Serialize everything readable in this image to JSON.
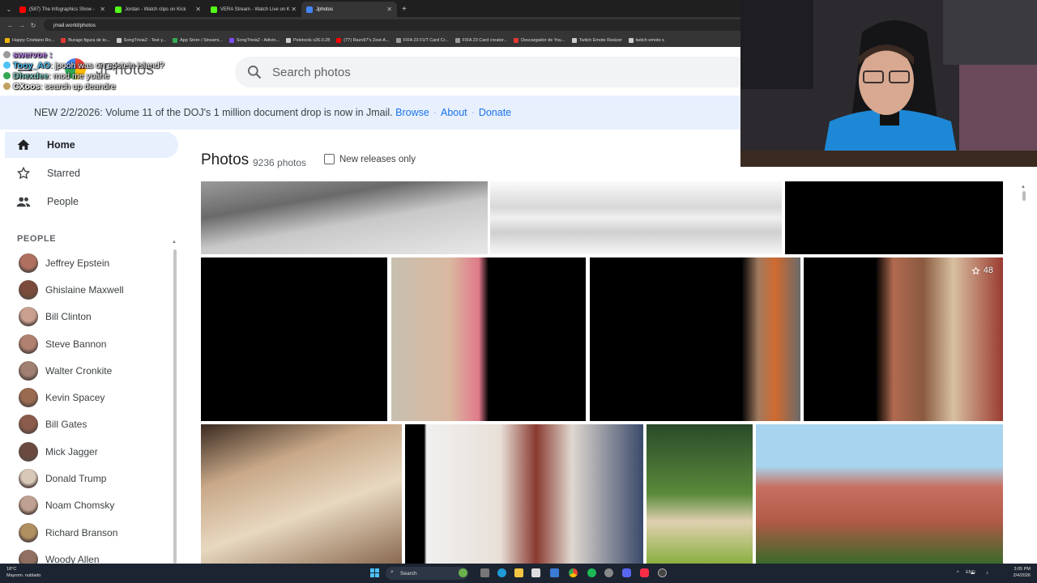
{
  "browser": {
    "tabs": [
      {
        "label": "(587) The Infographics Show -",
        "color": "#ff0000"
      },
      {
        "label": "Jordan - Watch clips on Kick",
        "color": "#53fc18"
      },
      {
        "label": "VERA Stream - Watch Live on K",
        "color": "#53fc18"
      },
      {
        "label": "Jphotos",
        "color": "#4285f4"
      }
    ],
    "url": "jmail.world/photos",
    "bookmarks": [
      {
        "label": "Happy Cristiano Ro...",
        "color": "#f4b400"
      },
      {
        "label": "Burago figura de to...",
        "color": "#e53935"
      },
      {
        "label": "SongTrivia2 - Test y...",
        "color": "#cccccc"
      },
      {
        "label": "App Store / Streami...",
        "color": "#34a853"
      },
      {
        "label": "SongTrivia2 - Adivin...",
        "color": "#7c4dff"
      },
      {
        "label": "Peletools v26.0.28",
        "color": "#cccccc"
      },
      {
        "label": "(77) Razo97's Zest-A...",
        "color": "#ff0000"
      },
      {
        "label": "FIFA 23 FUT Card Cr...",
        "color": "#999999"
      },
      {
        "label": "FIFA 23 Card creator...",
        "color": "#999999"
      },
      {
        "label": "Descargador de You...",
        "color": "#e53935"
      },
      {
        "label": "Twitch Emote Resizer",
        "color": "#cccccc"
      },
      {
        "label": "twitch emote s",
        "color": "#cccccc"
      }
    ]
  },
  "header": {
    "app_title": "JPhotos",
    "search_placeholder": "Search photos"
  },
  "notice": {
    "text": "NEW 2/2/2026: Volume 11 of the DOJ's 1 million document drop is now in Jmail.",
    "browse": "Browse",
    "about": "About",
    "donate": "Donate",
    "sep": "·"
  },
  "chat": [
    {
      "user": "swervoe :",
      "msg": "",
      "color": "#c58af9",
      "badge": "#999"
    },
    {
      "user": "Tooy_AO",
      "msg": ": jpooh was on epstein island?",
      "color": "#4fc3f7",
      "badge": "#4fc3f7"
    },
    {
      "user": "Dhexdee",
      "msg": ": mod me yoahe",
      "color": "#80cbc4",
      "badge": "#34a853"
    },
    {
      "user": "CXoos",
      "msg": ": search up deandre",
      "color": "#ffffff",
      "badge": "#c0a060"
    }
  ],
  "sidebar": {
    "nav": [
      {
        "label": "Home",
        "icon": "home-icon"
      },
      {
        "label": "Starred",
        "icon": "star-icon"
      },
      {
        "label": "People",
        "icon": "people-icon"
      }
    ],
    "people_heading": "PEOPLE",
    "people": [
      {
        "name": "Jeffrey Epstein",
        "color": "#b07060"
      },
      {
        "name": "Ghislaine Maxwell",
        "color": "#7a4a3a"
      },
      {
        "name": "Bill Clinton",
        "color": "#c9a090"
      },
      {
        "name": "Steve Bannon",
        "color": "#b08070"
      },
      {
        "name": "Walter Cronkite",
        "color": "#a08070"
      },
      {
        "name": "Kevin Spacey",
        "color": "#9a6a50"
      },
      {
        "name": "Bill Gates",
        "color": "#8a5a4a"
      },
      {
        "name": "Mick Jagger",
        "color": "#6a4a40"
      },
      {
        "name": "Donald Trump",
        "color": "#d8c8b8"
      },
      {
        "name": "Noam Chomsky",
        "color": "#c0a090"
      },
      {
        "name": "Richard Branson",
        "color": "#b09060"
      },
      {
        "name": "Woody Allen",
        "color": "#907060"
      }
    ]
  },
  "main": {
    "title": "Photos",
    "count": "9236 photos",
    "new_releases_label": "New releases only",
    "star_count": "48"
  },
  "taskbar": {
    "weather_temp": "18°C",
    "weather_desc": "Mayorm. nublado",
    "search_label": "Search",
    "lang": "ENG",
    "time": "3:05 PM",
    "date": "2/4/2026"
  }
}
